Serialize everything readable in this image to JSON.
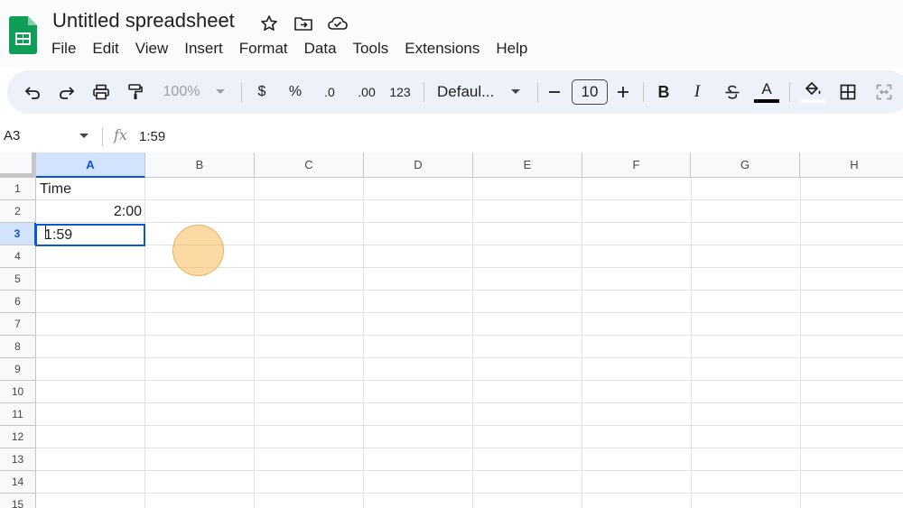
{
  "header": {
    "doc_title": "Untitled spreadsheet",
    "icons": [
      "star-icon",
      "move-to-folder-icon",
      "cloud-saved-icon"
    ]
  },
  "menu": [
    "File",
    "Edit",
    "View",
    "Insert",
    "Format",
    "Data",
    "Tools",
    "Extensions",
    "Help"
  ],
  "toolbar": {
    "zoom": "100%",
    "currency": "$",
    "percent": "%",
    "decrease_decimal": ".0",
    "increase_decimal": ".00",
    "number_format": "123",
    "font": "Defaul...",
    "font_size": "10",
    "bold": "B",
    "italic": "I",
    "text_color": "A"
  },
  "formula_bar": {
    "name_box": "A3",
    "fx": "fx",
    "value": "1:59"
  },
  "grid": {
    "columns": [
      "A",
      "B",
      "C",
      "D",
      "E",
      "F",
      "G",
      "H"
    ],
    "rows": [
      "1",
      "2",
      "3",
      "4",
      "5",
      "6",
      "7",
      "8",
      "9",
      "10",
      "11",
      "12",
      "13",
      "14",
      "15"
    ],
    "selected_column": "A",
    "selected_row": "3",
    "cells": {
      "A1": "Time",
      "A2": "2:00",
      "A3_editing": "1:59"
    }
  },
  "colors": {
    "accent": "#0b57d0",
    "selection_header": "#d3e3fd",
    "toolbar_bg": "#edf2fa",
    "sheets_green": "#0f9d58"
  }
}
